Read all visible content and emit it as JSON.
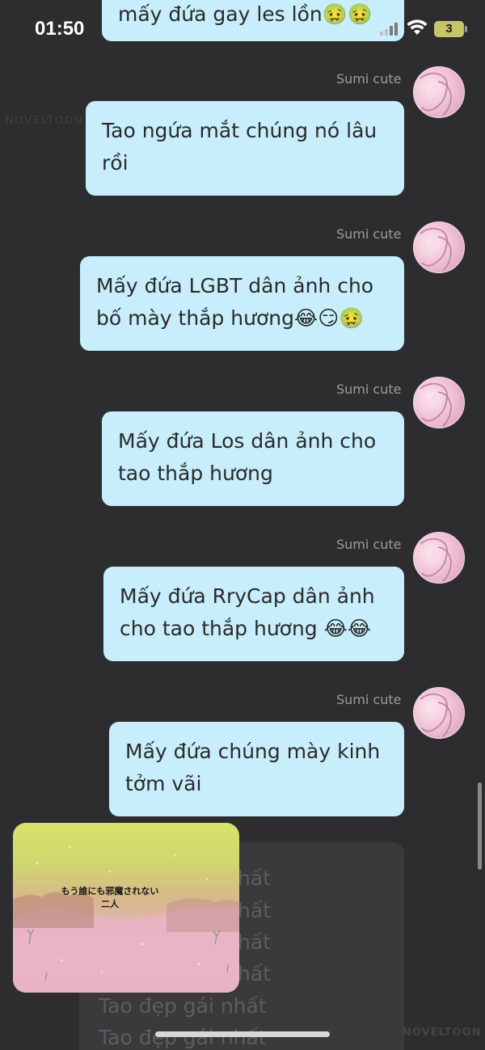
{
  "status_bar": {
    "time": "01:50",
    "battery": "3"
  },
  "messages": [
    {
      "sender": "",
      "text": "mấy đứa gay les lồn🤢🤢"
    },
    {
      "sender": "Sumi cute",
      "text": "Tao ngứa mắt chúng nó lâu rồi"
    },
    {
      "sender": "Sumi cute",
      "text": "Mấy đứa LGBT dân ảnh cho bố mày thắp hương😂😏🤢"
    },
    {
      "sender": "Sumi cute",
      "text": "Mấy đứa Los dân ảnh cho tao thắp hương"
    },
    {
      "sender": "Sumi cute",
      "text": "Mấy đứa RryCap dân ảnh cho tao thắp hương 😂😂"
    },
    {
      "sender": "Sumi cute",
      "text": "Mấy đứa chúng mày kinh tởm vãi"
    }
  ],
  "obscured_message": {
    "lines": [
      "hất",
      "hất",
      "hất",
      "hất",
      "Tao đẹp gái nhất",
      "Tao đẹp gái nhất"
    ]
  },
  "video_overlay": {
    "caption_line1": "もう誰にも邪魔されない",
    "caption_line2": "二人"
  },
  "colors": {
    "background": "#2d2d2f",
    "bubble": "#c8eefc",
    "sender_name": "#9c9c9e"
  }
}
